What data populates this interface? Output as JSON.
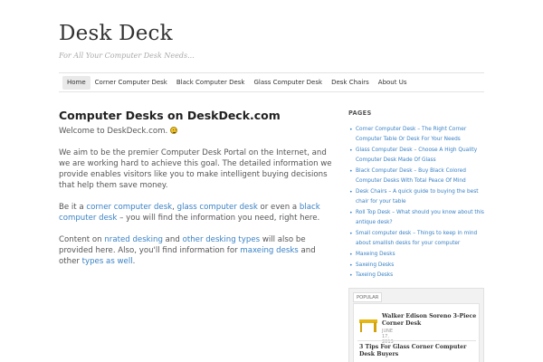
{
  "site": {
    "title": "Desk Deck",
    "tagline": "For All Your Computer Desk Needs..."
  },
  "nav": {
    "items": [
      {
        "label": "Home",
        "active": true
      },
      {
        "label": "Corner Computer Desk"
      },
      {
        "label": "Black Computer Desk"
      },
      {
        "label": "Glass Computer Desk"
      },
      {
        "label": "Desk Chairs"
      },
      {
        "label": "About Us"
      }
    ]
  },
  "post": {
    "title": "Computer Desks on DeskDeck.com",
    "p1": "Welcome to DeskDeck.com.",
    "p2": "We aim to be the premier Computer Desk Portal on the Internet, and we are working hard to achieve this goal.  The detailed information we provide enables visitors like you to make intelligent buying decisions that help them save money.",
    "p3": {
      "t1": "Be it a ",
      "l1": "corner computer desk",
      "t2": ", ",
      "l2": "glass computer desk",
      "t3": " or even a ",
      "l3": "black computer desk",
      "t4": " – you will find the information you need, right here."
    },
    "p4": {
      "t1": "Content on ",
      "l1": "nrated desking",
      "t2": " and ",
      "l2": "other desking types",
      "t3": " will also be provided here. Also, you'll find information for ",
      "l3": "maxeing desks",
      "t4": " and other ",
      "l4": "types as well",
      "t5": "."
    }
  },
  "sidebar": {
    "pages_title": "PAGES",
    "pages": [
      "Corner Computer Desk – The Right Corner Computer Table Or Desk For Your Needs",
      "Glass Computer Desk – Choose A High Quality Computer Desk Made Of Glass",
      "Black Computer Desk – Buy Black Colored Computer Desks With Total Peace Of Mind",
      "Desk Chairs – A quick guide to buying the best chair for your table",
      "Roll Top Desk – What should you know about this antique desk?",
      "Small computer desk – Things to keep in mind about smallish desks for your computer",
      "Maxeing Desks",
      "Saxeing Desks",
      "Taxeing Desks"
    ],
    "popular_tab": "POPULAR",
    "popular": [
      {
        "title": "Walker Edison Soreno 3-Piece Corner Desk",
        "date": "JUNE 17, 2013"
      },
      {
        "title": "3 Tips For Glass Corner Computer Desk Buyers"
      }
    ]
  }
}
